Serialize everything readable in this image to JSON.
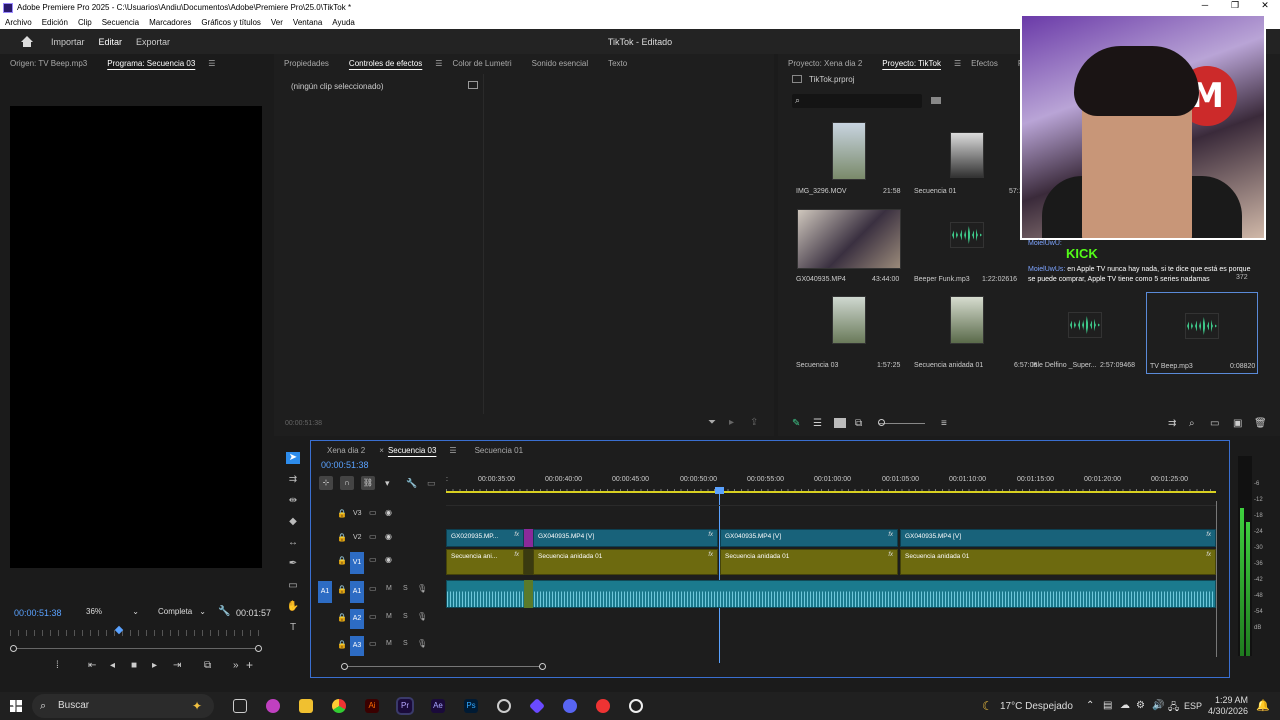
{
  "window": {
    "title": "Adobe Premiere Pro 2025 - C:\\Usuarios\\Andiu\\Documentos\\Adobe\\Premiere Pro\\25.0\\TikTok *",
    "controls": [
      "─",
      "❐",
      "✕"
    ]
  },
  "menu": [
    "Archivo",
    "Edición",
    "Clip",
    "Secuencia",
    "Marcadores",
    "Gráficos y títulos",
    "Ver",
    "Ventana",
    "Ayuda"
  ],
  "header": {
    "workspaces": [
      "Importar",
      "Editar",
      "Exportar"
    ],
    "active_workspace": "Editar",
    "project_title": "TikTok - Editado"
  },
  "monitor": {
    "tabs": [
      "Origen: TV Beep.mp3",
      "Programa: Secuencia 03"
    ],
    "timecode": "00:00:51:38",
    "zoom": "36%",
    "quality": "Completa",
    "duration": "00:01:57"
  },
  "effects_panel": {
    "tabs": [
      "Propiedades",
      "Controles de efectos",
      "Color de Lumetri",
      "Sonido esencial",
      "Texto"
    ],
    "active_tab": "Controles de efectos",
    "empty_message": "(ningún clip seleccionado)",
    "timecode": "00:00:51:38"
  },
  "project_panel": {
    "tabs": [
      "Proyecto: Xena dia 2",
      "Proyecto: TikTok",
      "Efectos",
      "Pl"
    ],
    "active_tab": "Proyecto: TikTok",
    "project_file": "TikTok.prproj",
    "items": [
      {
        "name": "IMG_3296.MOV",
        "duration": "21:58"
      },
      {
        "name": "Secuencia 01",
        "duration": "57:11"
      },
      {
        "name": "GX040935.MP4",
        "duration": "43:44:00"
      },
      {
        "name": "Beeper Funk.mp3",
        "duration": "1:22:02616"
      },
      {
        "name": "Secuencia 03",
        "duration": "1:57:25"
      },
      {
        "name": "Secuencia anidada 01",
        "duration": "6:57:06"
      },
      {
        "name": "Isle Delfino _Super...",
        "duration": "2:57:09468"
      },
      {
        "name": "TV Beep.mp3",
        "duration": "0:08820"
      }
    ]
  },
  "chat_overlay": {
    "brand": "KICK",
    "user1": "MoielUwU:",
    "user2": "MoielUwUs:",
    "message": "en Apple TV nunca hay nada, si te dice que está es porque se puede comprar, Apple TV tiene como 5 series nadamas",
    "extra_num": "372"
  },
  "timeline": {
    "tabs": [
      "Xena dia 2",
      "Secuencia 03",
      "Secuencia 01"
    ],
    "active_tab": "Secuencia 03",
    "timecode": "00:00:51:38",
    "ruler": [
      "00:00:35:00",
      "00:00:40:00",
      "00:00:45:00",
      "00:00:50:00",
      "00:00:55:00",
      "00:01:00:00",
      "00:01:05:00",
      "00:01:10:00",
      "00:01:15:00",
      "00:01:20:00",
      "00:01:25:00"
    ],
    "tracks": {
      "video": [
        "V3",
        "V2",
        "V1"
      ],
      "audio": [
        "A1",
        "A2",
        "A3"
      ],
      "source_v": "V1",
      "source_a": "A1",
      "ms": [
        "M",
        "S"
      ]
    },
    "clips": {
      "v2": [
        "GX020935.MP...",
        "GX040935.MP4 [V]",
        "GX040935.MP4 [V]",
        "GX040935.MP4 [V]"
      ],
      "v1": [
        "Secuencia ani...",
        "Secuencia anidada 01",
        "Secuencia anidada 01",
        "Secuencia anidada 01"
      ],
      "fx": "fx"
    }
  },
  "meters": {
    "scale": [
      "-6",
      "-12",
      "-18",
      "-24",
      "-30",
      "-36",
      "-42",
      "-48",
      "-54",
      "dB"
    ]
  },
  "taskbar": {
    "search_placeholder": "Buscar",
    "weather": "17°C  Despejado",
    "language": "ESP",
    "time": "1:29 AM",
    "date": "4/30/2026"
  },
  "colors": {
    "accent_blue": "#2d8ceb",
    "v1_clip": "#6d6a0f",
    "v2_clip": "#18627a",
    "a1_clip": "#1b7a8e",
    "playhead": "#5aa2ff"
  }
}
